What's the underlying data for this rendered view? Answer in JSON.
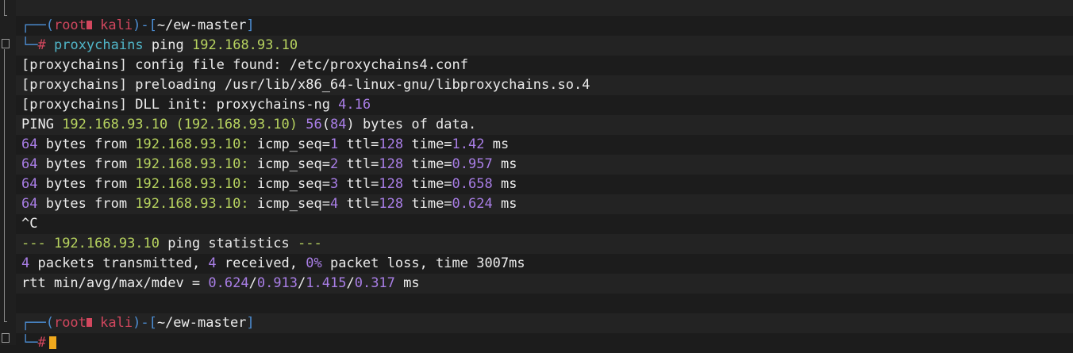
{
  "colors": {
    "background": "#1c1c1c",
    "prompt_frame": "#4d8fd6",
    "prompt_user": "#d2475e",
    "command": "#50b6c9",
    "ip_address": "#b7d35f",
    "number": "#a97ee6",
    "cursor": "#f0a91d"
  },
  "prompt1": {
    "frame_top": "┌──(",
    "user": "root",
    "host": "kali",
    "frame_mid": ")-[",
    "path": "~/ew-master",
    "frame_end": "]",
    "frame_bottom": "└─",
    "hash": "#",
    "cmd": "proxychains",
    "cmd_args": "ping",
    "target": "192.168.93.10"
  },
  "output": {
    "pc_tag": "[proxychains]",
    "line1_text": " config file found: /etc/proxychains4.conf",
    "line2_text": " preloading /usr/lib/x86_64-linux-gnu/libproxychains.so.4",
    "line3_text": " DLL init: proxychains-ng ",
    "line3_ver": "4.16",
    "ping_word": "PING ",
    "ping_ip": "192.168.93.10",
    "ping_ip_paren": " (192.168.93.10) ",
    "ping_size": "56",
    "ping_size_paren_open": "(",
    "ping_size2": "84",
    "ping_tail": ") bytes of data.",
    "replies": [
      {
        "bytes": "64",
        "mid": " bytes from ",
        "ip": "192.168.93.10:",
        "seq_label": " icmp_seq=",
        "seq": "1",
        "ttl_label": " ttl=",
        "ttl": "128",
        "time_label": " time=",
        "time": "1.42",
        "unit": " ms"
      },
      {
        "bytes": "64",
        "mid": " bytes from ",
        "ip": "192.168.93.10:",
        "seq_label": " icmp_seq=",
        "seq": "2",
        "ttl_label": " ttl=",
        "ttl": "128",
        "time_label": " time=",
        "time": "0.957",
        "unit": " ms"
      },
      {
        "bytes": "64",
        "mid": " bytes from ",
        "ip": "192.168.93.10:",
        "seq_label": " icmp_seq=",
        "seq": "3",
        "ttl_label": " ttl=",
        "ttl": "128",
        "time_label": " time=",
        "time": "0.658",
        "unit": " ms"
      },
      {
        "bytes": "64",
        "mid": " bytes from ",
        "ip": "192.168.93.10:",
        "seq_label": " icmp_seq=",
        "seq": "4",
        "ttl_label": " ttl=",
        "ttl": "128",
        "time_label": " time=",
        "time": "0.624",
        "unit": " ms"
      }
    ],
    "interrupt": "^C",
    "stats_dash1": "--- ",
    "stats_ip": "192.168.93.10",
    "stats_mid": " ping statistics ",
    "stats_dash2": "---",
    "sum_tx": "4",
    "sum_tx_label": " packets transmitted, ",
    "sum_rx": "4",
    "sum_rx_label": " received, ",
    "sum_loss": "0%",
    "sum_tail": " packet loss, time 3007ms",
    "rtt_label": "rtt min/avg/max/mdev = ",
    "rtt_min": "0.624",
    "sep1": "/",
    "rtt_avg": "0.913",
    "sep2": "/",
    "rtt_max": "1.415",
    "sep3": "/",
    "rtt_mdev": "0.317",
    "rtt_unit": " ms"
  },
  "prompt2": {
    "frame_top": "┌──(",
    "user": "root",
    "host": "kali",
    "frame_mid": ")-[",
    "path": "~/ew-master",
    "frame_end": "]",
    "frame_bottom": "└─",
    "hash": "#"
  }
}
